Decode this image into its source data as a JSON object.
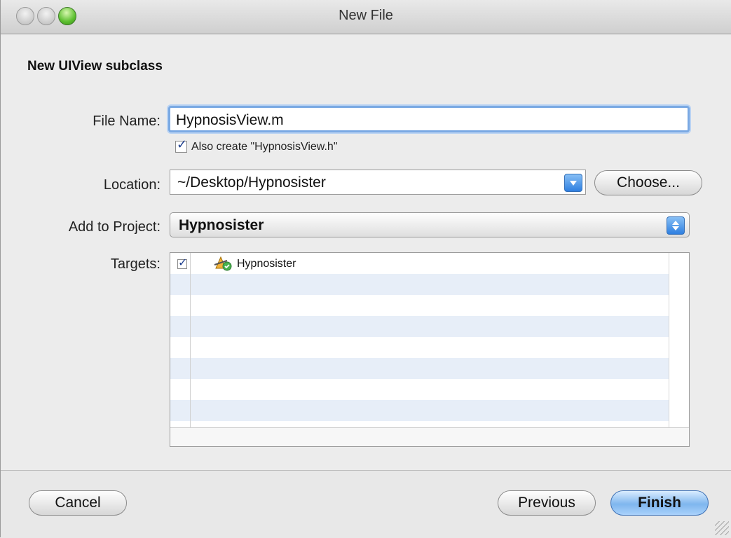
{
  "window": {
    "title": "New File"
  },
  "heading": "New UIView subclass",
  "form": {
    "file_name_label": "File Name:",
    "file_name_value": "HypnosisView.m",
    "also_create_label": "Also create \"HypnosisView.h\"",
    "location_label": "Location:",
    "location_value": "~/Desktop/Hypnosister",
    "choose_button": "Choose...",
    "add_to_project_label": "Add to Project:",
    "add_to_project_value": "Hypnosister",
    "targets_label": "Targets:",
    "targets": [
      {
        "name": "Hypnosister",
        "checked": true
      }
    ]
  },
  "buttons": {
    "cancel": "Cancel",
    "previous": "Previous",
    "finish": "Finish"
  },
  "colors": {
    "accent": "#2e7fe0",
    "stripe": "#e7eef8"
  }
}
